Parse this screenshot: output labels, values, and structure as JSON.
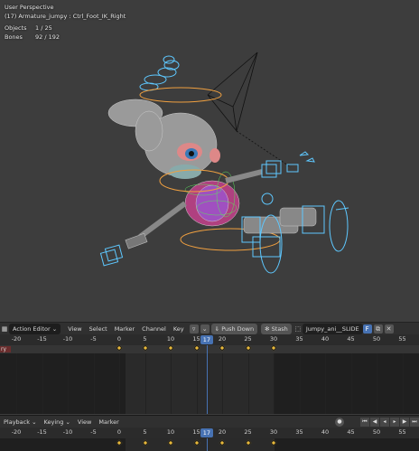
{
  "viewport": {
    "view_name": "User Perspective",
    "active_object": "(17) Armature_jumpy : Ctrl_Foot_IK_Right",
    "stats": [
      {
        "label": "Objects",
        "value": "1 / 25"
      },
      {
        "label": "Bones",
        "value": "92 / 192"
      }
    ]
  },
  "action_editor": {
    "editor_type": "Action Editor",
    "menus": [
      "View",
      "Select",
      "Marker",
      "Channel",
      "Key"
    ],
    "push_down_label": "Push Down",
    "stash_label": "Stash",
    "action_name": "Jumpy_ani__SLIDE",
    "channel_label": "ry",
    "ruler_ticks": [
      "-20",
      "-15",
      "-10",
      "-5",
      "0",
      "5",
      "10",
      "15",
      "20",
      "25",
      "30",
      "35",
      "40",
      "45",
      "50",
      "55"
    ],
    "current_frame": "17"
  },
  "timeline": {
    "playback_label": "Playback",
    "keying_label": "Keying",
    "menus": [
      "View",
      "Marker"
    ],
    "ruler_ticks": [
      "-20",
      "-15",
      "-10",
      "-5",
      "0",
      "5",
      "10",
      "15",
      "20",
      "25",
      "30",
      "35",
      "40",
      "45",
      "50",
      "55"
    ],
    "current_frame": "17",
    "transport_icons": [
      "jump-start-icon",
      "prev-key-icon",
      "reverse-play-icon",
      "play-icon",
      "next-key-icon",
      "jump-end-icon"
    ]
  },
  "colors": {
    "accent": "#4772b3",
    "keyframe": "#e8b83a",
    "bone_blue": "#5ec8ff",
    "bone_orange": "#f0a040",
    "bone_green": "#5ee05e",
    "background": "#3d3d3d"
  }
}
